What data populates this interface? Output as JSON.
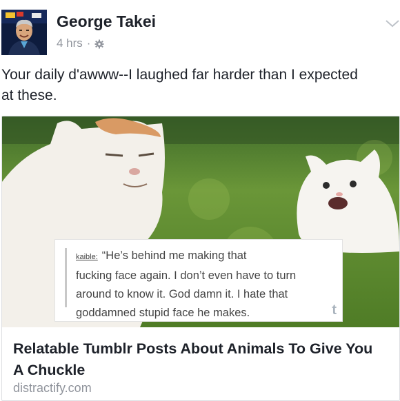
{
  "post": {
    "author": "George Takei",
    "timestamp": "4 hrs",
    "separator": "·",
    "audience_icon": "gear-icon",
    "menu_icon": "chevron-down-icon",
    "text_line1": "Your daily d'awww--I laughed far harder than I expected",
    "text_line2": "at these."
  },
  "link_card": {
    "tumblr_user": "kaible:",
    "quote_line1": "“He’s behind me making that",
    "quote_line2": "fucking face again. I don’t even have to turn",
    "quote_line3": "around to know it. God damn it. I hate that",
    "quote_line4": "goddamned stupid face he makes.",
    "tumblr_logo": "t",
    "title_line1": "Relatable Tumblr Posts About Animals To Give You",
    "title_line2": "A Chuckle",
    "domain": "distractify.com"
  },
  "colors": {
    "name": "#1d2129",
    "meta": "#90949c",
    "grass": "#5f8a2e",
    "cat": "#f3f0ea"
  }
}
